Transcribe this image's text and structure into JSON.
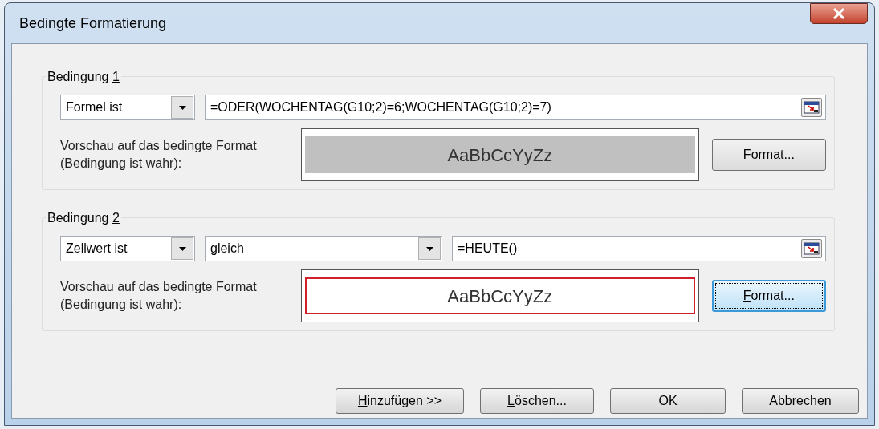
{
  "window": {
    "title": "Bedingte Formatierung"
  },
  "conditions": [
    {
      "label": {
        "before": "Bedingung ",
        "key": "1"
      },
      "type": "Formel ist",
      "formula": "=ODER(WOCHENTAG(G10;2)=6;WOCHENTAG(G10;2)=7)",
      "preview_label": "Vorschau auf das bedingte Format (Bedingung ist wahr):",
      "preview_text": "AaBbCcYyZz",
      "preview_fill": {
        "color": "#c0c0c0"
      },
      "preview_border": {
        "color": "#c0c0c0"
      },
      "format_button": {
        "key": "F",
        "after": "ormat...",
        "focused": false
      }
    },
    {
      "label": {
        "before": "Bedingung ",
        "key": "2"
      },
      "type": "Zellwert ist",
      "operator": "gleich",
      "formula": "=HEUTE()",
      "preview_label": "Vorschau auf das bedingte Format (Bedingung ist wahr):",
      "preview_text": "AaBbCcYyZz",
      "preview_fill": {
        "color": "#ffffff"
      },
      "preview_border": {
        "color": "#d0202a"
      },
      "format_button": {
        "key": "F",
        "after": "ormat...",
        "focused": true
      }
    }
  ],
  "buttons": [
    {
      "key": "H",
      "after": "inzufügen >>"
    },
    {
      "key": "L",
      "after": "öschen..."
    },
    {
      "before": "OK"
    },
    {
      "before": "Abbrechen"
    }
  ]
}
